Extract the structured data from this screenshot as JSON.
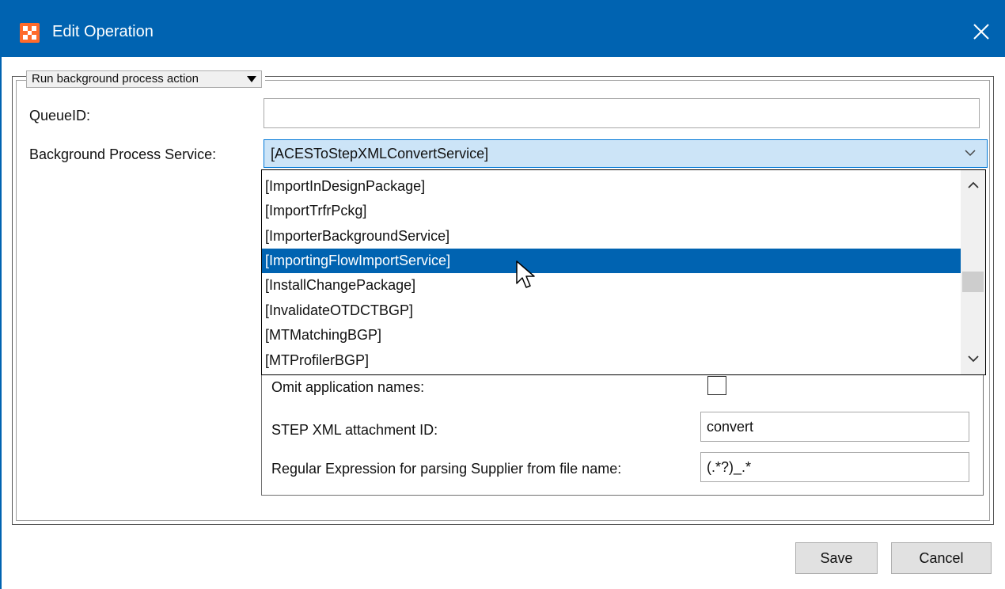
{
  "window": {
    "title": "Edit Operation",
    "icon": "app-grid-icon",
    "close_icon": "close-icon"
  },
  "action_selector": {
    "label": "Run background process action",
    "icon": "dropdown-arrow-icon"
  },
  "form": {
    "queue_id_label": "QueueID:",
    "queue_id_value": "",
    "bg_service_label": "Background Process Service:",
    "bg_service_value": "[ACESToStepXMLConvertService]"
  },
  "dropdown": {
    "items": [
      "[ImportInDesignPackage]",
      "[ImportTrfrPckg]",
      "[ImporterBackgroundService]",
      "[ImportingFlowImportService]",
      "[InstallChangePackage]",
      "[InvalidateOTDCTBGP]",
      "[MTMatchingBGP]",
      "[MTProfilerBGP]"
    ],
    "selected_index": 3
  },
  "parameters": {
    "omit_app_names_label": "Omit application names:",
    "omit_app_names_checked": false,
    "step_xml_label": "STEP XML attachment ID:",
    "step_xml_value": "convert",
    "regex_label": "Regular Expression for parsing Supplier from file name:",
    "regex_value": "(.*?)_.*"
  },
  "buttons": {
    "save": "Save",
    "cancel": "Cancel"
  },
  "colors": {
    "titlebar": "#0063b1",
    "selection": "#0063b1",
    "combo_highlight": "#cce4f7",
    "app_icon": "#ff6a2a"
  }
}
